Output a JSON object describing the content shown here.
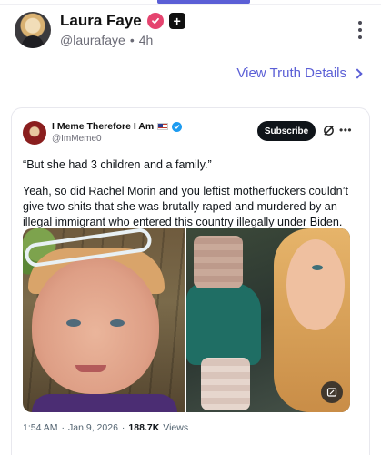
{
  "post": {
    "author": {
      "display_name": "Laura Faye",
      "handle": "@laurafaye",
      "separator": "•",
      "time_ago": "4h",
      "verified_color": "#e5446f"
    },
    "details_link": "View Truth Details",
    "accent_color": "#5b5fd6"
  },
  "embed": {
    "author": {
      "display_name": "I Meme Therefore I Am",
      "handle": "@ImMeme0",
      "subscribe_label": "Subscribe"
    },
    "paragraphs": [
      "“But she had 3 children and a family.”",
      "Yeah, so did Rachel Morin and you leftist motherfuckers couldn’t give two shits that she was brutally raped and murdered by an illegal immigrant who entered this country illegally under Biden."
    ],
    "footer": {
      "time": "1:54 AM",
      "separator_1": "·",
      "date": "Jan 9, 2026",
      "separator_2": "·",
      "views_count": "188.7K",
      "views_label": "Views"
    },
    "icons": [
      "flag-icon",
      "verified-icon",
      "grok-icon",
      "more-icon",
      "alt-text-icon"
    ]
  }
}
